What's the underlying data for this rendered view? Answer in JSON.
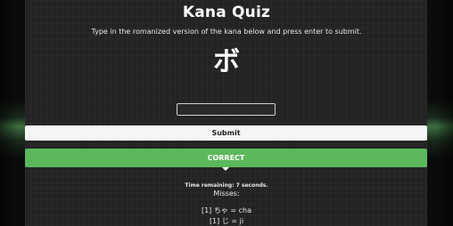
{
  "app": {
    "title": "Kana Quiz",
    "instructions": "Type in the romanized version of the kana below and press enter to submit."
  },
  "quiz": {
    "kana": "ボ",
    "input_value": "",
    "submit_label": "Submit",
    "result_text": "CORRECT",
    "time_remaining": "Time remaining: 7 seconds.",
    "misses_label": "Misses:",
    "misses": [
      "[1] ちゃ = cha",
      "[1] じ = ji"
    ]
  },
  "colors": {
    "panel": "#232323",
    "correct": "#5cb85c",
    "button": "#f6f6f6"
  }
}
